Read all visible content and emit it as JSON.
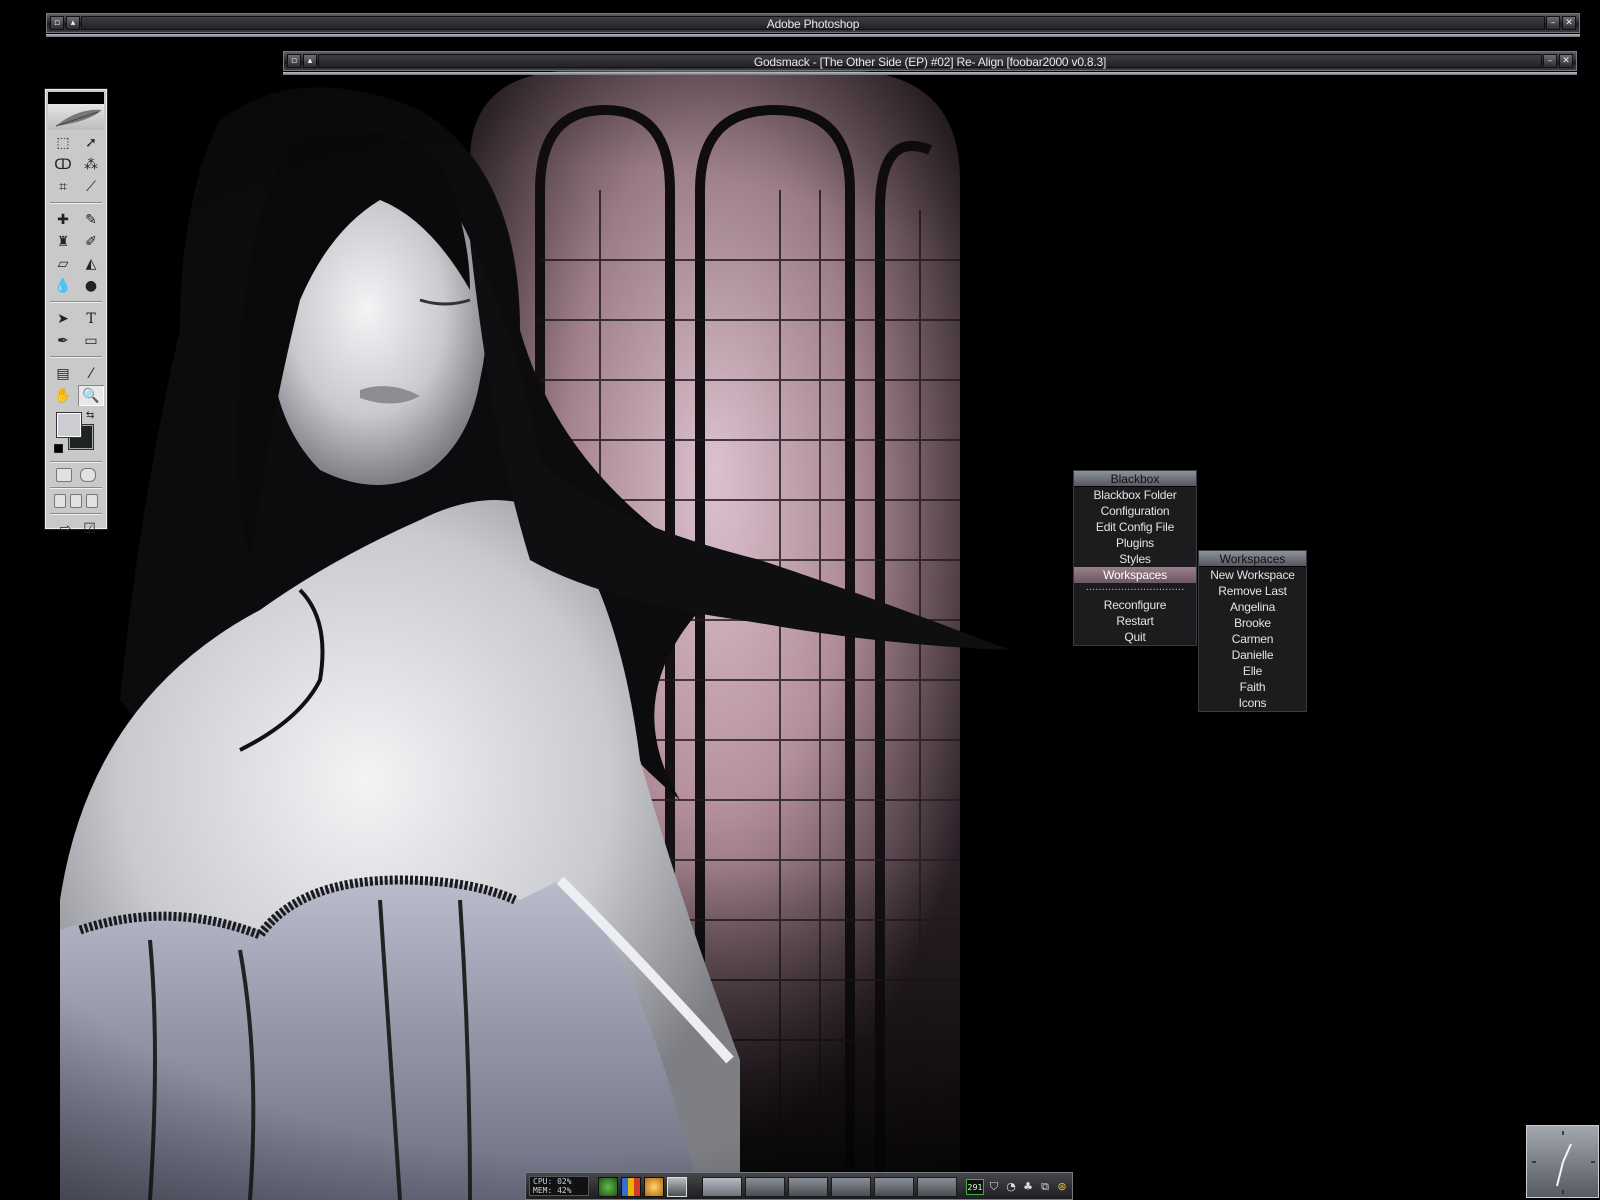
{
  "windows": {
    "photoshop": {
      "title": "Adobe Photoshop"
    },
    "foobar": {
      "title": "Godsmack - [The Other Side (EP) #02] Re- Align    [foobar2000 v0.8.3]"
    }
  },
  "blackbox_menu": {
    "title": "Blackbox",
    "items": [
      {
        "label": "Blackbox Folder"
      },
      {
        "label": "Configuration"
      },
      {
        "label": "Edit Config File"
      },
      {
        "label": "Plugins"
      },
      {
        "label": "Styles"
      },
      {
        "label": "Workspaces",
        "highlighted": true
      }
    ],
    "separator": "...............................",
    "items_after": [
      {
        "label": "Reconfigure"
      },
      {
        "label": "Restart"
      },
      {
        "label": "Quit"
      }
    ]
  },
  "workspaces_menu": {
    "title": "Workspaces",
    "items": [
      {
        "label": "New Workspace"
      },
      {
        "label": "Remove Last"
      },
      {
        "label": "Angelina"
      },
      {
        "label": "Brooke"
      },
      {
        "label": "Carmen"
      },
      {
        "label": "Danielle"
      },
      {
        "label": "Elle"
      },
      {
        "label": "Faith"
      },
      {
        "label": "Icons"
      }
    ]
  },
  "taskbar": {
    "cpu_label": "CPU:",
    "cpu_value": "02%",
    "mem_label": "MEM:",
    "mem_value": "42%",
    "tray_number": "291"
  },
  "colors": {
    "menu_highlight": "#9a7f8a",
    "titlebar": "#2c2e32",
    "foreground_swatch": "#cbcdd3",
    "background_swatch": "#1d2421"
  },
  "toolbox": {
    "tools": [
      "marquee-icon",
      "move-icon",
      "lasso-icon",
      "magic-wand-icon",
      "crop-icon",
      "slice-icon",
      "healing-brush-icon",
      "brush-icon",
      "clone-stamp-icon",
      "history-brush-icon",
      "eraser-icon",
      "paint-bucket-icon",
      "blur-icon",
      "dodge-icon",
      "path-selection-icon",
      "type-icon",
      "pen-icon",
      "rectangle-icon",
      "notes-icon",
      "eyedropper-icon",
      "hand-icon",
      "zoom-icon"
    ]
  }
}
